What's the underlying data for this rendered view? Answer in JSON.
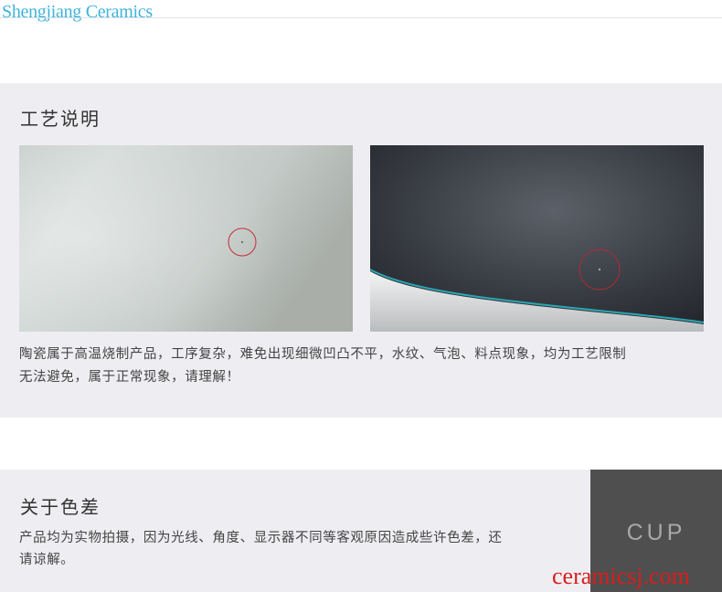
{
  "site": {
    "watermark_top": "Shengjiang Ceramics",
    "watermark_bottom": "ceramicsj.com"
  },
  "craft": {
    "title": "工艺说明",
    "photos": [
      {
        "name": "light-glaze-photo",
        "tone": "#cfd6d3"
      },
      {
        "name": "dark-glaze-photo",
        "tone": "#3c4048"
      }
    ],
    "note_line1": "陶瓷属于高温烧制产品，工序复杂，难免出现细微凹凸不平，水纹、气泡、料点现象，均为工艺限制",
    "note_line2": "无法避免，属于正常现象，请理解！"
  },
  "color": {
    "title": "关于色差",
    "note_line1": "产品均为实物拍摄，因为光线、角度、显示器不同等客观原因造成些许色差，还",
    "note_line2": "请谅解。"
  },
  "cup": {
    "label": "CUP"
  },
  "colors": {
    "panel_bg": "#eeeef2",
    "marker_red": "#c0303a",
    "cup_block": "#4f4f4f",
    "watermark_blue": "#3fb3dc",
    "watermark_red": "#d81e1e"
  }
}
